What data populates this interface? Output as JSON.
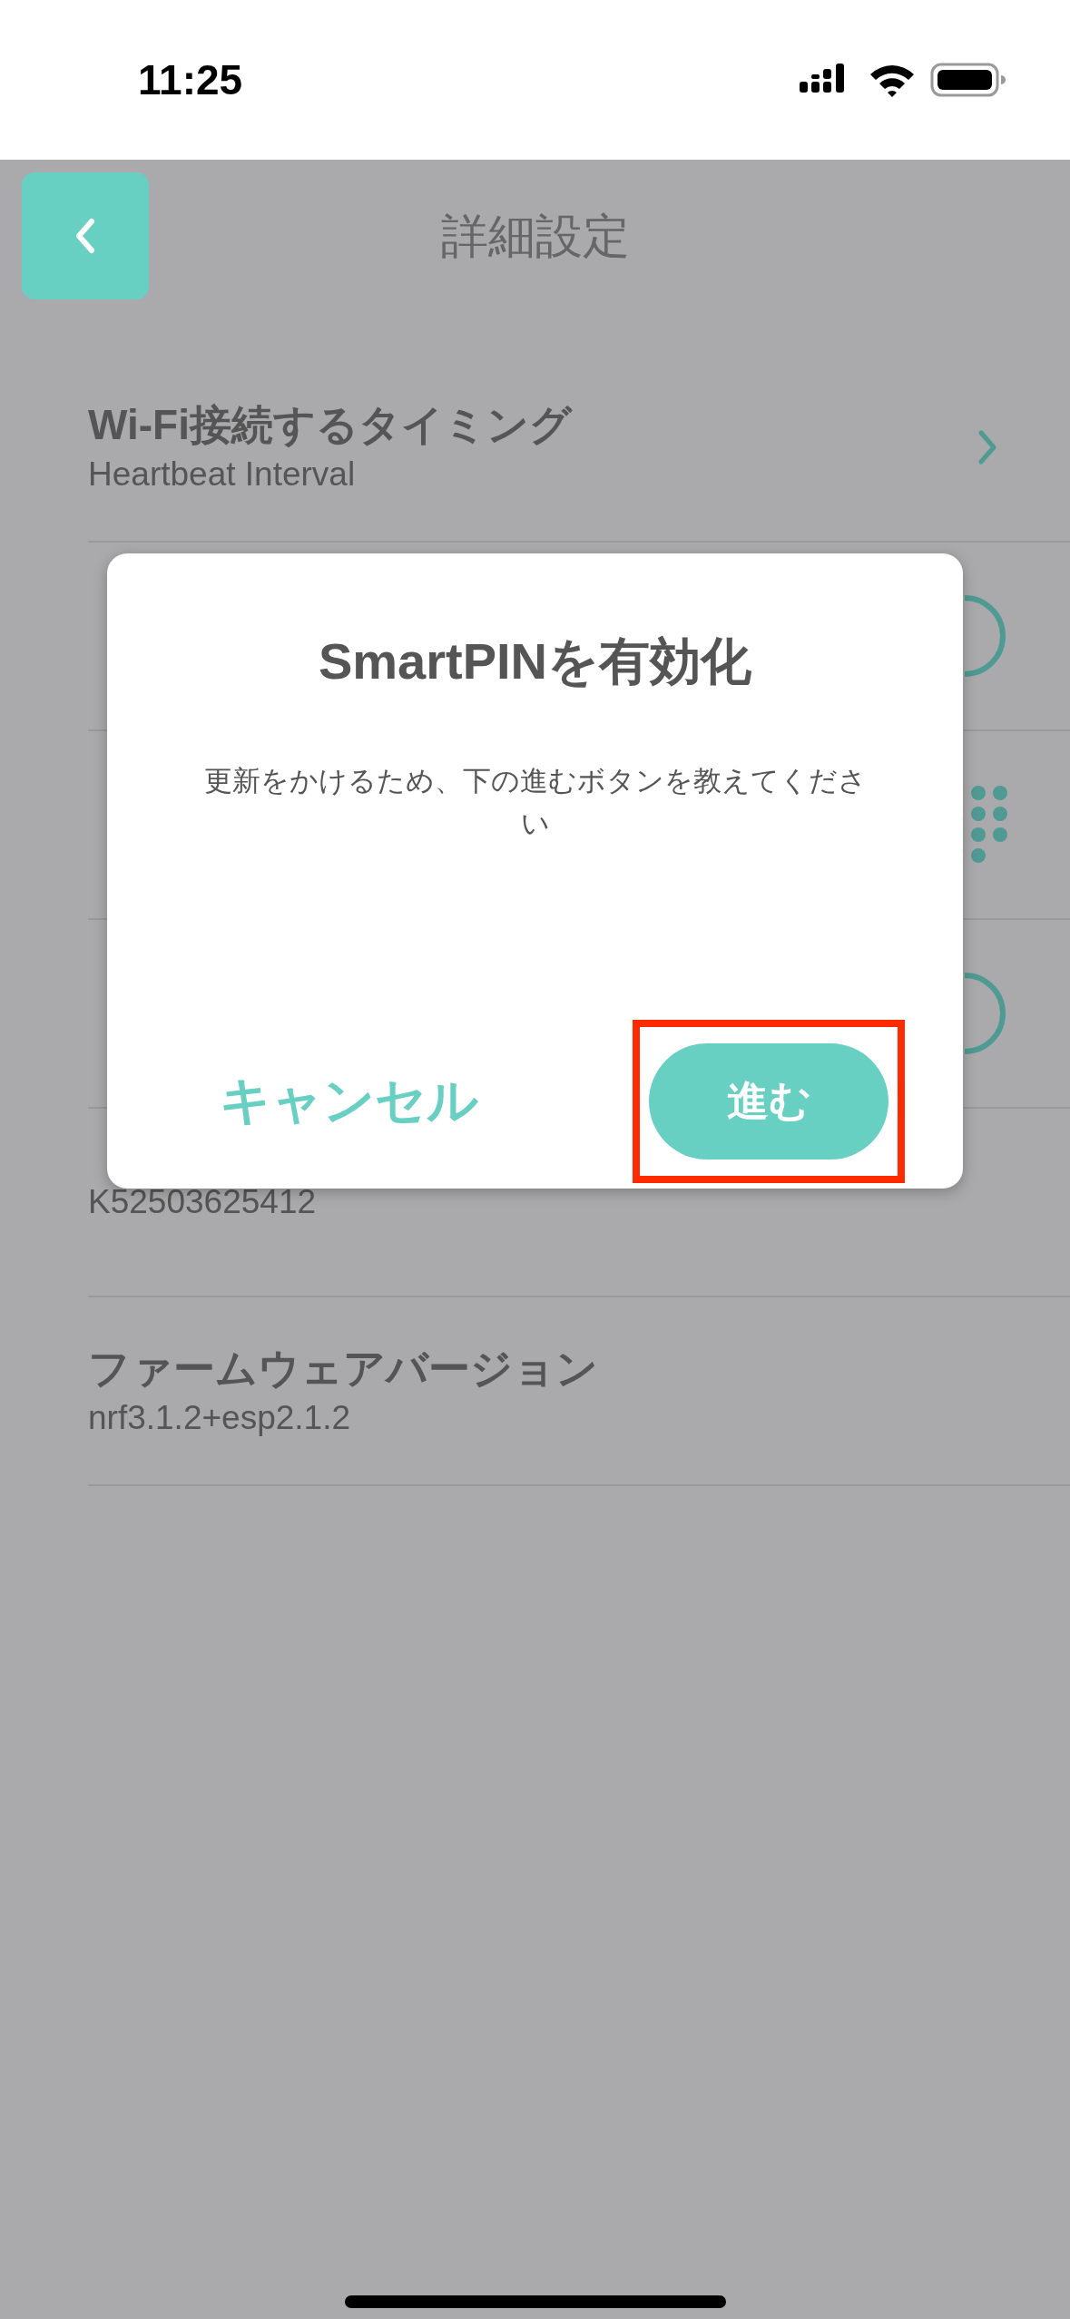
{
  "status_bar": {
    "time": "11:25"
  },
  "header": {
    "title": "詳細設定"
  },
  "rows": [
    {
      "title": "Wi-Fi接続するタイミング",
      "subtitle": "Heartbeat Interval",
      "kind": "chevron"
    },
    {
      "kind": "ring"
    },
    {
      "kind": "keypad"
    },
    {
      "kind": "ring"
    },
    {
      "subtitle": "K52503625412",
      "kind": "plain"
    },
    {
      "title": "ファームウェアバージョン",
      "subtitle": "nrf3.1.2+esp2.1.2",
      "kind": "plain"
    }
  ],
  "dialog": {
    "title": "SmartPINを有効化",
    "message": "更新をかけるため、下の進むボタンを教えてください",
    "cancel": "キャンセル",
    "confirm": {
      "label": "進む",
      "highlighted": true
    }
  }
}
